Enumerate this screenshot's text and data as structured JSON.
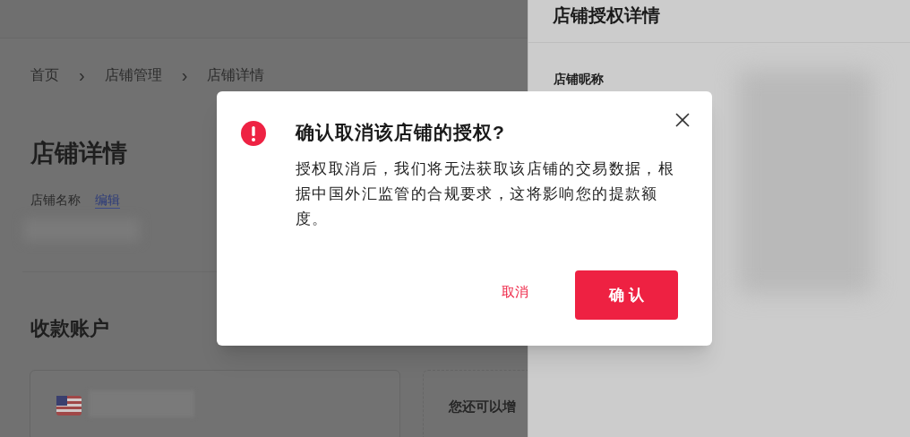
{
  "breadcrumb": [
    {
      "label": "首页"
    },
    {
      "label": "店铺管理"
    },
    {
      "label": "店铺详情"
    }
  ],
  "breadcrumb_separator": "›",
  "page_title": "店铺详情",
  "store_name": {
    "label": "店铺名称",
    "edit_link": "编辑"
  },
  "section_title": "收款账户",
  "add_card": {
    "text": "您还可以增"
  },
  "drawer": {
    "title": "店铺授权详情",
    "field_label": "店铺昵称"
  },
  "dialog": {
    "title": "确认取消该店铺的授权?",
    "body": "授权取消后，我们将无法获取该店铺的交易数据，根据中国外汇监管的合规要求，这将影响您的提款额度。",
    "cancel": "取消",
    "confirm": "确 认"
  }
}
